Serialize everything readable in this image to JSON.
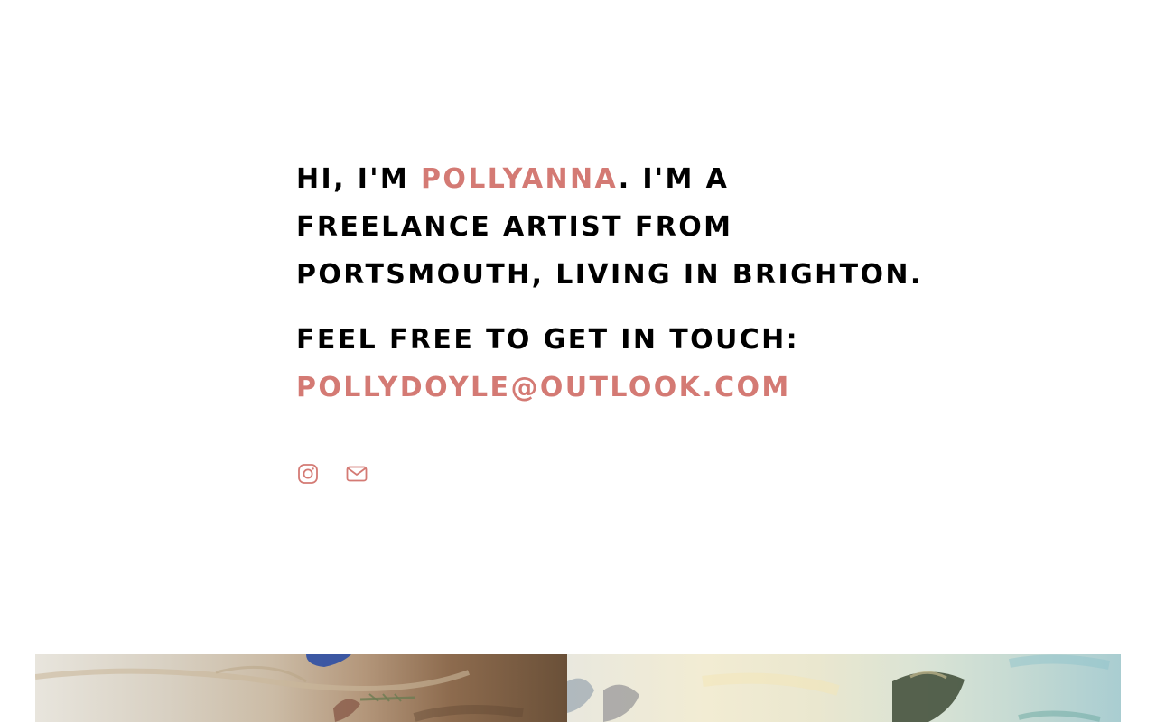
{
  "intro": {
    "line1_pre": "HI, I'M ",
    "name": "POLLYANNA",
    "line1_post": ". I'M A",
    "line2": "FREELANCE ARTIST FROM",
    "line3": "PORTSMOUTH, LIVING IN BRIGHTON."
  },
  "contact": {
    "prompt": "FEEL FREE TO GET IN TOUCH:",
    "email": "POLLYDOYLE@OUTLOOK.COM"
  },
  "social": {
    "icons": [
      "instagram-icon",
      "mail-icon"
    ]
  },
  "colors": {
    "accent": "#d47a74",
    "text": "#000000",
    "background": "#ffffff"
  }
}
